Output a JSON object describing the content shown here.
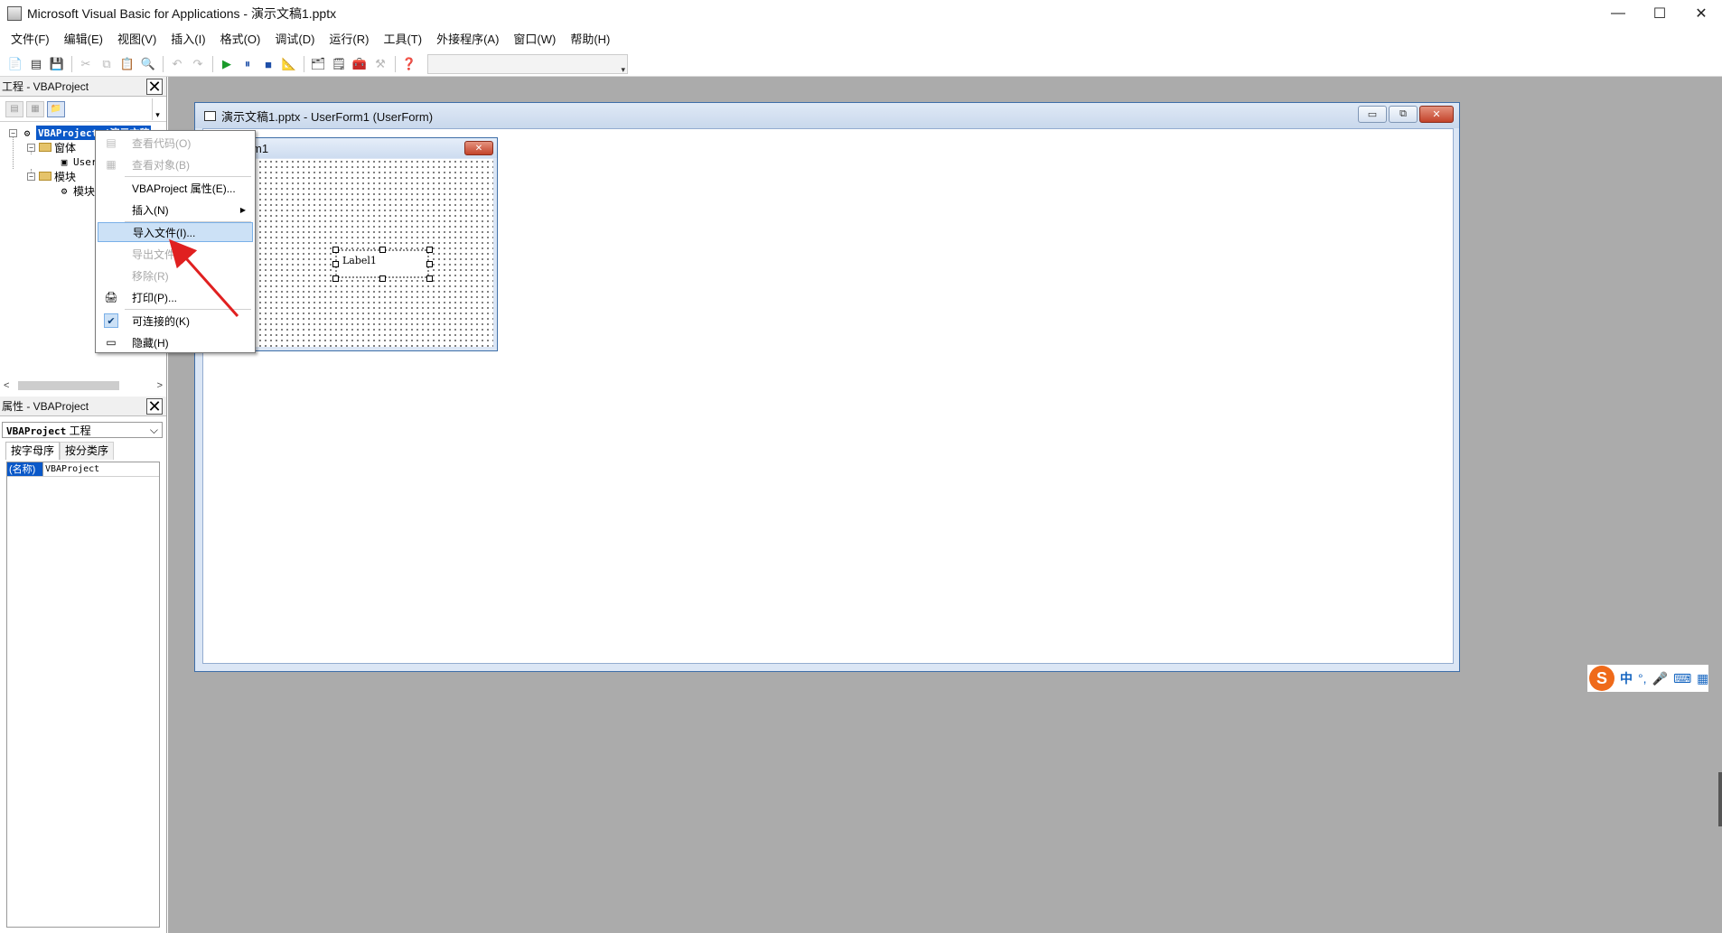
{
  "window": {
    "title": "Microsoft Visual Basic for Applications - 演示文稿1.pptx",
    "minimize": "—",
    "maximize": "☐",
    "close": "✕"
  },
  "menubar": {
    "items": [
      "文件(F)",
      "编辑(E)",
      "视图(V)",
      "插入(I)",
      "格式(O)",
      "调试(D)",
      "运行(R)",
      "工具(T)",
      "外接程序(A)",
      "窗口(W)",
      "帮助(H)"
    ]
  },
  "project_pane": {
    "title": "工程 - VBAProject",
    "close": "✕",
    "tree": {
      "root": "VBAProject (演示文稿",
      "forms_folder": "窗体",
      "form_item": "User",
      "modules_folder": "模块",
      "module_item": "模块"
    },
    "scroll_left": "<",
    "scroll_right": ">"
  },
  "props_pane": {
    "title": "属性 - VBAProject",
    "close": "✕",
    "object_name": "VBAProject",
    "object_type": "工程",
    "tabs": [
      "按字母序",
      "按分类序"
    ],
    "rows": [
      {
        "name": "(名称)",
        "value": "VBAProject"
      }
    ]
  },
  "form_window": {
    "title": "演示文稿1.pptx - UserForm1 (UserForm)",
    "min": "▭",
    "restore": "⧉",
    "close": "✕"
  },
  "userform": {
    "title": "m1",
    "close": "✕",
    "label": "Label1"
  },
  "context_menu": {
    "items": [
      {
        "label": "查看代码(O)",
        "disabled": true
      },
      {
        "label": "查看对象(B)",
        "disabled": true
      },
      {
        "label": "VBAProject 属性(E)...",
        "disabled": false
      },
      {
        "label": "插入(N)",
        "disabled": false,
        "submenu": "▶"
      },
      {
        "label": "导入文件(I)...",
        "disabled": false,
        "highlighted": true
      },
      {
        "label": "导出文件(",
        "disabled": true
      },
      {
        "label": "移除(R)",
        "disabled": true
      },
      {
        "label": "打印(P)...",
        "disabled": false
      },
      {
        "label": "可连接的(K)",
        "disabled": false,
        "checked": true
      },
      {
        "label": "隐藏(H)",
        "disabled": false
      }
    ]
  },
  "ime": {
    "logo": "S",
    "lang": "中",
    "punct": "°,",
    "mic": "🎤",
    "keyboard": "⌨",
    "grid": "▦"
  },
  "colors": {
    "mdi_bg": "#ababab",
    "selection": "#0a58c8",
    "menu_highlight": "#cce1f6",
    "arrow": "#e02020"
  }
}
